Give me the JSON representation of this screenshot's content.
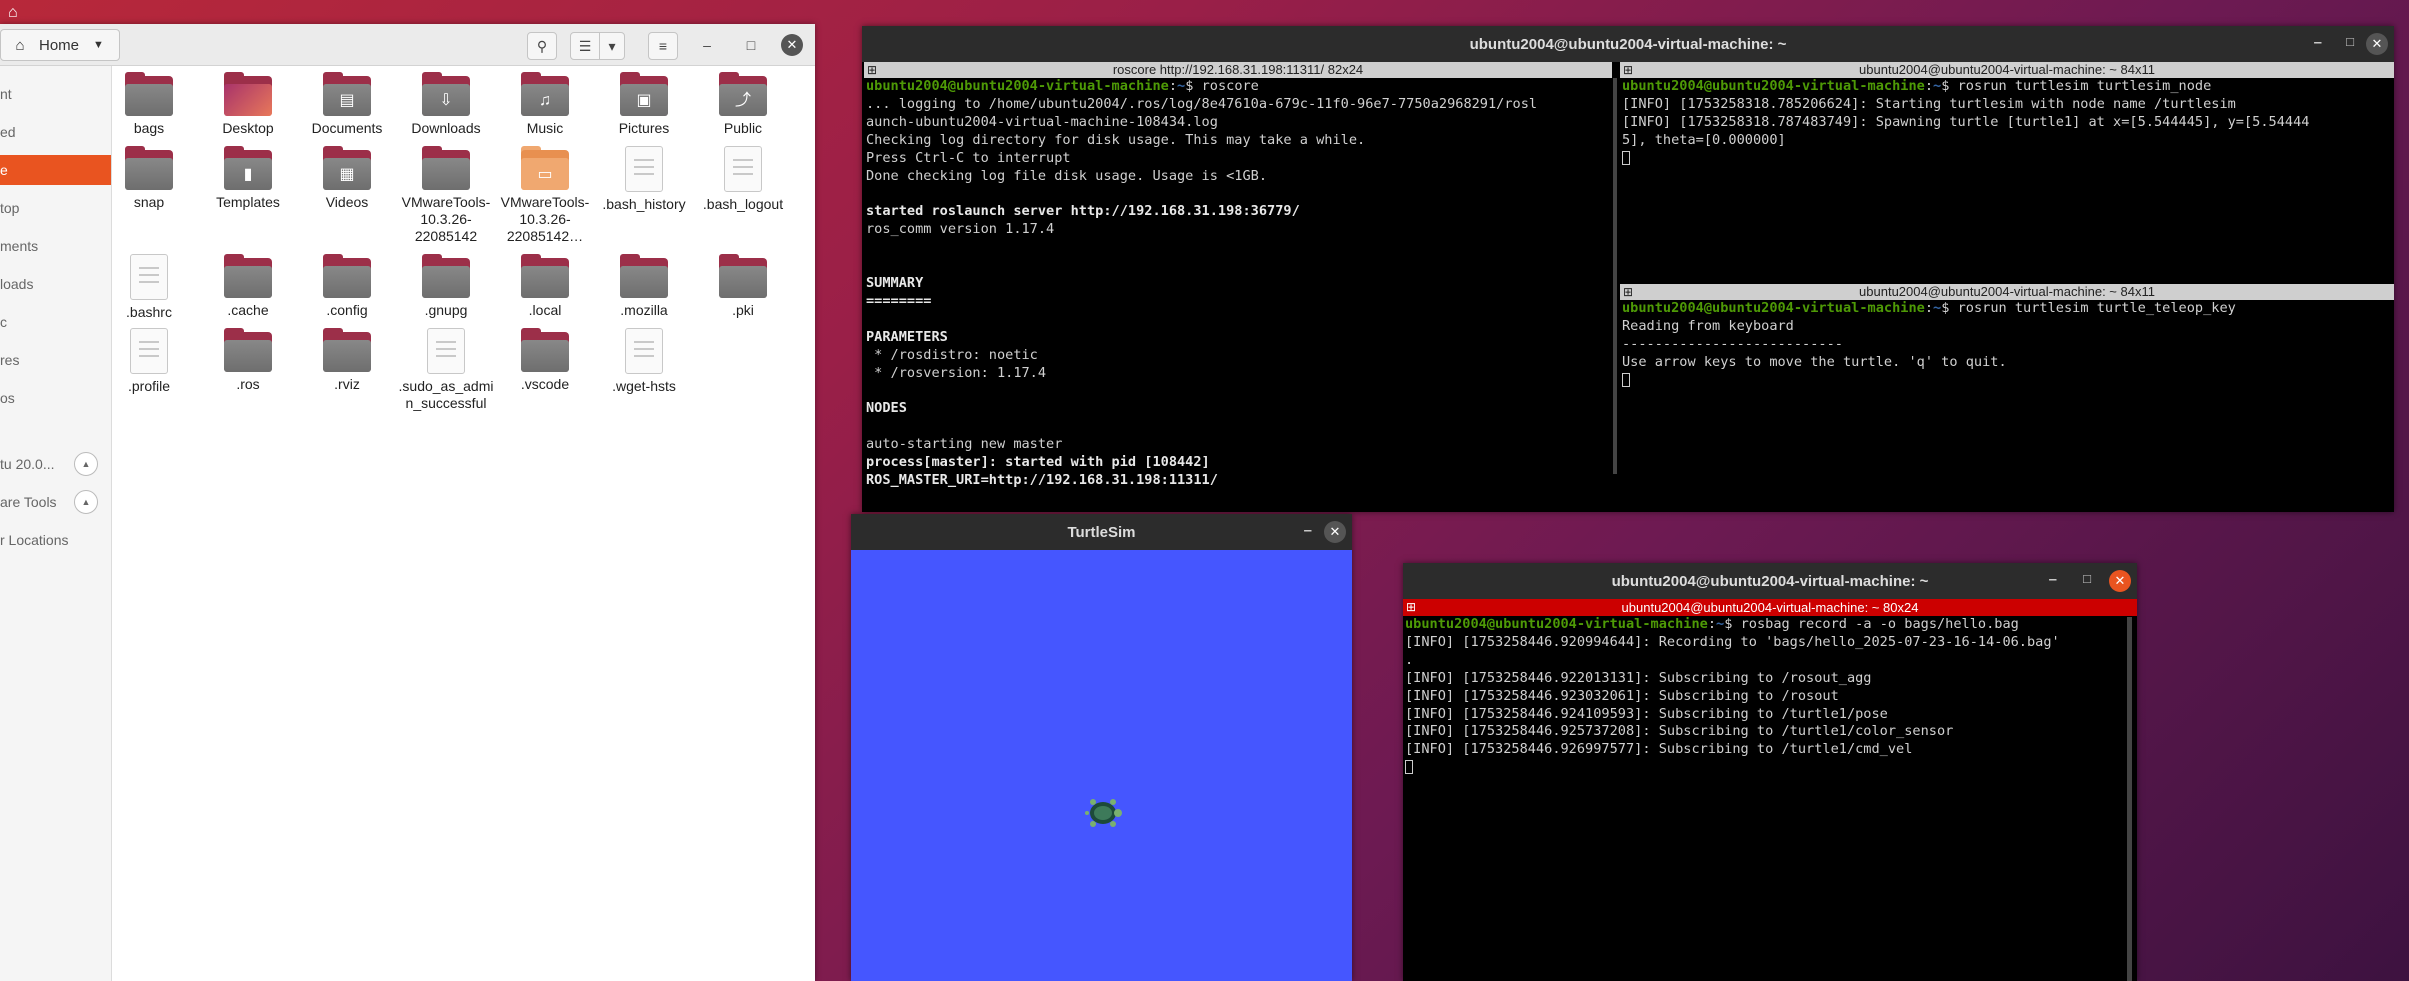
{
  "desktop": {
    "top_icon": "home-icon"
  },
  "files": {
    "path_label": "Home",
    "sidebar": [
      {
        "label": "nt"
      },
      {
        "label": "ed"
      },
      {
        "label": "e"
      },
      {
        "label": "top"
      },
      {
        "label": "ments"
      },
      {
        "label": "loads"
      },
      {
        "label": "c"
      },
      {
        "label": "res"
      },
      {
        "label": "os"
      },
      {
        "label": "tu 20.0..."
      },
      {
        "label": "are Tools"
      },
      {
        "label": "r Locations"
      }
    ],
    "items": [
      {
        "name": "bags",
        "kind": "folder",
        "emblem": ""
      },
      {
        "name": "Desktop",
        "kind": "desktop",
        "emblem": ""
      },
      {
        "name": "Documents",
        "kind": "folder",
        "emblem": "▤"
      },
      {
        "name": "Downloads",
        "kind": "folder",
        "emblem": "⇩"
      },
      {
        "name": "Music",
        "kind": "folder",
        "emblem": "♫"
      },
      {
        "name": "Pictures",
        "kind": "folder",
        "emblem": "▣"
      },
      {
        "name": "Public",
        "kind": "folder",
        "emblem": "⤴"
      },
      {
        "name": "snap",
        "kind": "folder",
        "emblem": ""
      },
      {
        "name": "Templates",
        "kind": "folder",
        "emblem": "▮"
      },
      {
        "name": "Videos",
        "kind": "folder",
        "emblem": "▦"
      },
      {
        "name": "VMwareTools-10.3.26-22085142",
        "kind": "folder",
        "emblem": ""
      },
      {
        "name": "VMwareTools-10.3.26-22085142…",
        "kind": "zip",
        "emblem": "▭"
      },
      {
        "name": ".bash_history",
        "kind": "doc",
        "emblem": ""
      },
      {
        "name": ".bash_logout",
        "kind": "doc",
        "emblem": ""
      },
      {
        "name": ".bashrc",
        "kind": "doc",
        "emblem": ""
      },
      {
        "name": ".cache",
        "kind": "folder",
        "emblem": ""
      },
      {
        "name": ".config",
        "kind": "folder",
        "emblem": ""
      },
      {
        "name": ".gnupg",
        "kind": "folder",
        "emblem": ""
      },
      {
        "name": ".local",
        "kind": "folder",
        "emblem": ""
      },
      {
        "name": ".mozilla",
        "kind": "folder",
        "emblem": ""
      },
      {
        "name": ".pki",
        "kind": "folder",
        "emblem": ""
      },
      {
        "name": ".profile",
        "kind": "doc",
        "emblem": ""
      },
      {
        "name": ".ros",
        "kind": "folder",
        "emblem": ""
      },
      {
        "name": ".rviz",
        "kind": "folder",
        "emblem": ""
      },
      {
        "name": ".sudo_as_admin_successful",
        "kind": "doc",
        "emblem": ""
      },
      {
        "name": ".vscode",
        "kind": "folder",
        "emblem": ""
      },
      {
        "name": ".wget-hsts",
        "kind": "doc",
        "emblem": ""
      }
    ]
  },
  "terminal_main": {
    "title": "ubuntu2004@ubuntu2004-virtual-machine: ~",
    "roscore_pane": {
      "title": "roscore http://192.168.31.198:11311/ 82x24",
      "prompt_user": "ubuntu2004@ubuntu2004-virtual-machine",
      "prompt_path": "~",
      "command": "roscore",
      "lines": [
        "... logging to /home/ubuntu2004/.ros/log/8e47610a-679c-11f0-96e7-7750a2968291/rosl",
        "aunch-ubuntu2004-virtual-machine-108434.log",
        "Checking log directory for disk usage. This may take a while.",
        "Press Ctrl-C to interrupt",
        "Done checking log file disk usage. Usage is <1GB.",
        "",
        "started roslaunch server http://192.168.31.198:36779/",
        "ros_comm version 1.17.4",
        "",
        "",
        "SUMMARY",
        "========",
        "",
        "PARAMETERS",
        " * /rosdistro: noetic",
        " * /rosversion: 1.17.4",
        "",
        "NODES",
        "",
        "auto-starting new master",
        "process[master]: started with pid [108442]",
        "ROS_MASTER_URI=http://192.168.31.198:11311/"
      ]
    },
    "turtlesim_pane": {
      "title": "ubuntu2004@ubuntu2004-virtual-machine: ~ 84x11",
      "prompt_user": "ubuntu2004@ubuntu2004-virtual-machine",
      "prompt_path": "~",
      "command": "rosrun turtlesim turtlesim_node",
      "lines": [
        "[INFO] [1753258318.785206624]: Starting turtlesim with node name /turtlesim",
        "[INFO] [1753258318.787483749]: Spawning turtle [turtle1] at x=[5.544445], y=[5.54444",
        "5], theta=[0.000000]"
      ]
    },
    "teleop_pane": {
      "title": "ubuntu2004@ubuntu2004-virtual-machine: ~ 84x11",
      "prompt_user": "ubuntu2004@ubuntu2004-virtual-machine",
      "prompt_path": "~",
      "command": "rosrun turtlesim turtle_teleop_key",
      "lines": [
        "Reading from keyboard",
        "---------------------------",
        "Use arrow keys to move the turtle. 'q' to quit."
      ]
    }
  },
  "turtlesim_window": {
    "title": "TurtleSim",
    "background": "#4556ff"
  },
  "terminal_rosbag": {
    "title": "ubuntu2004@ubuntu2004-virtual-machine: ~",
    "pane_title": "ubuntu2004@ubuntu2004-virtual-machine: ~ 80x24",
    "prompt_user": "ubuntu2004@ubuntu2004-virtual-machine",
    "prompt_path": "~",
    "command": "rosbag record -a -o bags/hello.bag",
    "lines": [
      "[INFO] [1753258446.920994644]: Recording to 'bags/hello_2025-07-23-16-14-06.bag'",
      ".",
      "[INFO] [1753258446.922013131]: Subscribing to /rosout_agg",
      "[INFO] [1753258446.923032061]: Subscribing to /rosout",
      "[INFO] [1753258446.924109593]: Subscribing to /turtle1/pose",
      "[INFO] [1753258446.925737208]: Subscribing to /turtle1/color_sensor",
      "[INFO] [1753258446.926997577]: Subscribing to /turtle1/cmd_vel"
    ]
  },
  "colors": {
    "accent": "#e95420",
    "prompt_green": "#4e9a06",
    "prompt_blue": "#3465a4",
    "folder": "#9c2f49",
    "active_pane_title": "#cc0000"
  }
}
